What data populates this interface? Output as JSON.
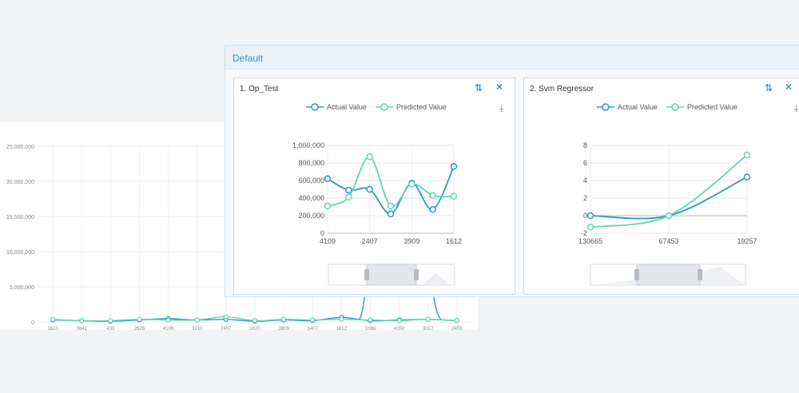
{
  "background_chart": {
    "y_ticks": [
      "25,000,000",
      "20,000,000",
      "15,000,000",
      "10,000,000",
      "5,000,000",
      "0"
    ],
    "x_ticks": [
      "1610",
      "3641",
      "433",
      "2626",
      "4109",
      "3210",
      "2407",
      "1620",
      "3909",
      "1407",
      "1612",
      "1068",
      "4350",
      "3027",
      "2455"
    ]
  },
  "panel": {
    "title": "Default"
  },
  "cards": [
    {
      "title": "1. Op_Test",
      "refresh_icon": "refresh-icon",
      "close_icon": "close-icon",
      "download_icon": "download-icon"
    },
    {
      "title": "2. Svm Regressor",
      "refresh_icon": "refresh-icon",
      "close_icon": "close-icon",
      "download_icon": "download-icon"
    }
  ],
  "colors": {
    "actual": "#2a9bb8",
    "predicted": "#5fd6b2",
    "accent": "#2a7fc1"
  },
  "chart_data": [
    {
      "type": "line",
      "categories": [
        "4109",
        "2407",
        "3909",
        "1612"
      ],
      "ylim": [
        0,
        1000000
      ],
      "y_ticks": [
        0,
        200000,
        400000,
        600000,
        800000,
        1000000
      ],
      "y_tick_labels": [
        "0",
        "200,000",
        "400,000",
        "600,000",
        "800,000",
        "1,000,000"
      ],
      "x": [
        0,
        0.5,
        1,
        1.5,
        2,
        2.5,
        3
      ],
      "legend_position": "top",
      "series": [
        {
          "name": "Actual Value",
          "values": [
            620000,
            490000,
            500000,
            220000,
            570000,
            270000,
            760000
          ]
        },
        {
          "name": "Predicted Value",
          "values": [
            310000,
            410000,
            870000,
            310000,
            560000,
            430000,
            420000
          ]
        }
      ]
    },
    {
      "type": "line",
      "categories": [
        "130665",
        "67453",
        "19257"
      ],
      "ylim": [
        -2,
        8
      ],
      "y_ticks": [
        -2,
        0,
        2,
        4,
        6,
        8
      ],
      "y_tick_labels": [
        "-2",
        "0",
        "2",
        "4",
        "6",
        "8"
      ],
      "x": [
        0,
        1,
        2
      ],
      "legend_position": "top",
      "series": [
        {
          "name": "Actual Value",
          "values": [
            0,
            0,
            4.4
          ]
        },
        {
          "name": "Predicted Value",
          "values": [
            -1.3,
            0,
            6.9
          ]
        }
      ]
    }
  ]
}
